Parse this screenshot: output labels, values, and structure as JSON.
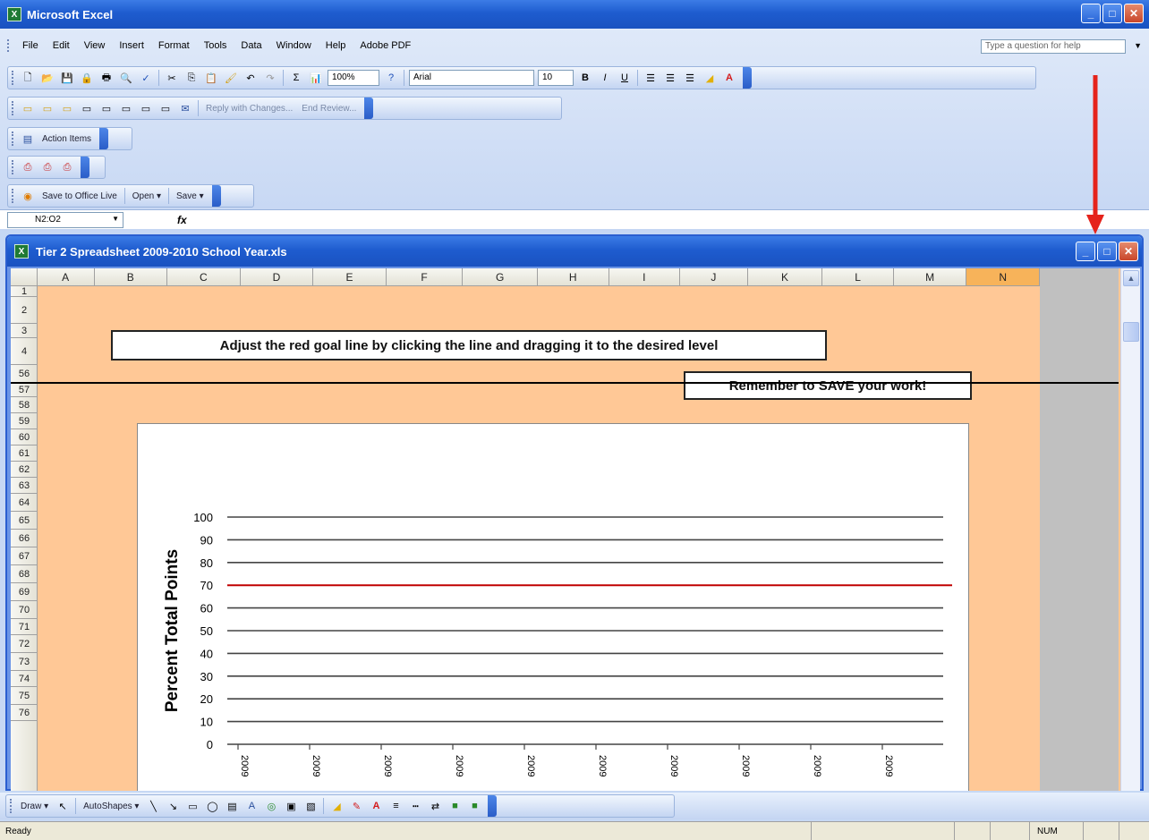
{
  "app": {
    "title": "Microsoft Excel",
    "logo": "X"
  },
  "window_buttons": {
    "minimize": "_",
    "maximize": "□",
    "close": "✕"
  },
  "menu": {
    "items": [
      "File",
      "Edit",
      "View",
      "Insert",
      "Format",
      "Tools",
      "Data",
      "Window",
      "Help",
      "Adobe PDF"
    ],
    "help_placeholder": "Type a question for help"
  },
  "standard_toolbar": {
    "zoom": "100%",
    "font": "Arial",
    "font_size": "10",
    "bold": "B",
    "italic": "I",
    "underline": "U",
    "sum": "Σ"
  },
  "reviewing_toolbar": {
    "reply_label": "Reply with Changes...",
    "end_review_label": "End Review..."
  },
  "action_toolbar": {
    "label": "Action Items"
  },
  "office_live_toolbar": {
    "save_to_label": "Save to Office Live",
    "open_label": "Open ▾",
    "save_label": "Save ▾"
  },
  "formula_bar": {
    "name_box": "N2:O2",
    "fx": "fx"
  },
  "workbook": {
    "title": "Tier 2 Spreadsheet 2009-2010 School Year.xls",
    "columns": [
      "A",
      "B",
      "C",
      "D",
      "E",
      "F",
      "G",
      "H",
      "I",
      "J",
      "K",
      "L",
      "M",
      "N"
    ],
    "selected_column": "N",
    "rows": [
      "1",
      "2",
      "3",
      "4",
      "56",
      "57",
      "58",
      "59",
      "60",
      "61",
      "62",
      "63",
      "64",
      "65",
      "66",
      "67",
      "68",
      "69",
      "70",
      "71",
      "72",
      "73",
      "74",
      "75",
      "76"
    ],
    "instruction": "Adjust the red goal line by clicking the  line and dragging it to the desired level",
    "reminder": "Remember to SAVE your work!"
  },
  "chart_data": {
    "type": "line",
    "ylabel": "Percent Total Points",
    "ylim": [
      0,
      100
    ],
    "yticks": [
      0,
      10,
      20,
      30,
      40,
      50,
      60,
      70,
      80,
      90,
      100
    ],
    "x": [
      "2009",
      "2009",
      "2009",
      "2009",
      "2009",
      "2009",
      "2009",
      "2009",
      "2009",
      "2009"
    ],
    "gridlines": [
      10,
      20,
      30,
      40,
      50,
      60,
      80,
      90,
      100
    ],
    "goal_line": {
      "value": 70,
      "color": "#c00000"
    }
  },
  "drawing_toolbar": {
    "draw_label": "Draw ▾",
    "autoshapes_label": "AutoShapes ▾"
  },
  "status": {
    "left": "Ready",
    "num": "NUM"
  },
  "colors": {
    "sheet_bg": "#ffc896",
    "accent_red": "#e5231b",
    "title_blue": "#1e5ccf"
  }
}
